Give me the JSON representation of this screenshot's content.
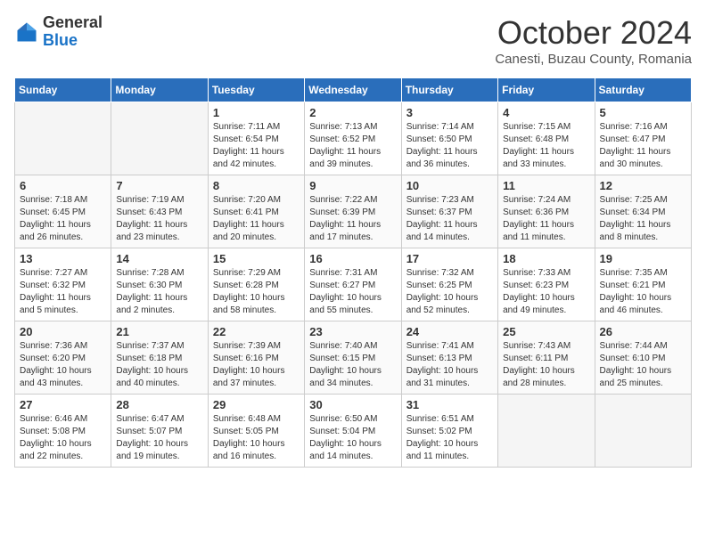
{
  "logo": {
    "general": "General",
    "blue": "Blue"
  },
  "title": "October 2024",
  "subtitle": "Canesti, Buzau County, Romania",
  "days_header": [
    "Sunday",
    "Monday",
    "Tuesday",
    "Wednesday",
    "Thursday",
    "Friday",
    "Saturday"
  ],
  "weeks": [
    [
      {
        "num": "",
        "info": "",
        "empty": true
      },
      {
        "num": "",
        "info": "",
        "empty": true
      },
      {
        "num": "1",
        "info": "Sunrise: 7:11 AM\nSunset: 6:54 PM\nDaylight: 11 hours and 42 minutes.",
        "empty": false
      },
      {
        "num": "2",
        "info": "Sunrise: 7:13 AM\nSunset: 6:52 PM\nDaylight: 11 hours and 39 minutes.",
        "empty": false
      },
      {
        "num": "3",
        "info": "Sunrise: 7:14 AM\nSunset: 6:50 PM\nDaylight: 11 hours and 36 minutes.",
        "empty": false
      },
      {
        "num": "4",
        "info": "Sunrise: 7:15 AM\nSunset: 6:48 PM\nDaylight: 11 hours and 33 minutes.",
        "empty": false
      },
      {
        "num": "5",
        "info": "Sunrise: 7:16 AM\nSunset: 6:47 PM\nDaylight: 11 hours and 30 minutes.",
        "empty": false
      }
    ],
    [
      {
        "num": "6",
        "info": "Sunrise: 7:18 AM\nSunset: 6:45 PM\nDaylight: 11 hours and 26 minutes.",
        "empty": false
      },
      {
        "num": "7",
        "info": "Sunrise: 7:19 AM\nSunset: 6:43 PM\nDaylight: 11 hours and 23 minutes.",
        "empty": false
      },
      {
        "num": "8",
        "info": "Sunrise: 7:20 AM\nSunset: 6:41 PM\nDaylight: 11 hours and 20 minutes.",
        "empty": false
      },
      {
        "num": "9",
        "info": "Sunrise: 7:22 AM\nSunset: 6:39 PM\nDaylight: 11 hours and 17 minutes.",
        "empty": false
      },
      {
        "num": "10",
        "info": "Sunrise: 7:23 AM\nSunset: 6:37 PM\nDaylight: 11 hours and 14 minutes.",
        "empty": false
      },
      {
        "num": "11",
        "info": "Sunrise: 7:24 AM\nSunset: 6:36 PM\nDaylight: 11 hours and 11 minutes.",
        "empty": false
      },
      {
        "num": "12",
        "info": "Sunrise: 7:25 AM\nSunset: 6:34 PM\nDaylight: 11 hours and 8 minutes.",
        "empty": false
      }
    ],
    [
      {
        "num": "13",
        "info": "Sunrise: 7:27 AM\nSunset: 6:32 PM\nDaylight: 11 hours and 5 minutes.",
        "empty": false
      },
      {
        "num": "14",
        "info": "Sunrise: 7:28 AM\nSunset: 6:30 PM\nDaylight: 11 hours and 2 minutes.",
        "empty": false
      },
      {
        "num": "15",
        "info": "Sunrise: 7:29 AM\nSunset: 6:28 PM\nDaylight: 10 hours and 58 minutes.",
        "empty": false
      },
      {
        "num": "16",
        "info": "Sunrise: 7:31 AM\nSunset: 6:27 PM\nDaylight: 10 hours and 55 minutes.",
        "empty": false
      },
      {
        "num": "17",
        "info": "Sunrise: 7:32 AM\nSunset: 6:25 PM\nDaylight: 10 hours and 52 minutes.",
        "empty": false
      },
      {
        "num": "18",
        "info": "Sunrise: 7:33 AM\nSunset: 6:23 PM\nDaylight: 10 hours and 49 minutes.",
        "empty": false
      },
      {
        "num": "19",
        "info": "Sunrise: 7:35 AM\nSunset: 6:21 PM\nDaylight: 10 hours and 46 minutes.",
        "empty": false
      }
    ],
    [
      {
        "num": "20",
        "info": "Sunrise: 7:36 AM\nSunset: 6:20 PM\nDaylight: 10 hours and 43 minutes.",
        "empty": false
      },
      {
        "num": "21",
        "info": "Sunrise: 7:37 AM\nSunset: 6:18 PM\nDaylight: 10 hours and 40 minutes.",
        "empty": false
      },
      {
        "num": "22",
        "info": "Sunrise: 7:39 AM\nSunset: 6:16 PM\nDaylight: 10 hours and 37 minutes.",
        "empty": false
      },
      {
        "num": "23",
        "info": "Sunrise: 7:40 AM\nSunset: 6:15 PM\nDaylight: 10 hours and 34 minutes.",
        "empty": false
      },
      {
        "num": "24",
        "info": "Sunrise: 7:41 AM\nSunset: 6:13 PM\nDaylight: 10 hours and 31 minutes.",
        "empty": false
      },
      {
        "num": "25",
        "info": "Sunrise: 7:43 AM\nSunset: 6:11 PM\nDaylight: 10 hours and 28 minutes.",
        "empty": false
      },
      {
        "num": "26",
        "info": "Sunrise: 7:44 AM\nSunset: 6:10 PM\nDaylight: 10 hours and 25 minutes.",
        "empty": false
      }
    ],
    [
      {
        "num": "27",
        "info": "Sunrise: 6:46 AM\nSunset: 5:08 PM\nDaylight: 10 hours and 22 minutes.",
        "empty": false
      },
      {
        "num": "28",
        "info": "Sunrise: 6:47 AM\nSunset: 5:07 PM\nDaylight: 10 hours and 19 minutes.",
        "empty": false
      },
      {
        "num": "29",
        "info": "Sunrise: 6:48 AM\nSunset: 5:05 PM\nDaylight: 10 hours and 16 minutes.",
        "empty": false
      },
      {
        "num": "30",
        "info": "Sunrise: 6:50 AM\nSunset: 5:04 PM\nDaylight: 10 hours and 14 minutes.",
        "empty": false
      },
      {
        "num": "31",
        "info": "Sunrise: 6:51 AM\nSunset: 5:02 PM\nDaylight: 10 hours and 11 minutes.",
        "empty": false
      },
      {
        "num": "",
        "info": "",
        "empty": true
      },
      {
        "num": "",
        "info": "",
        "empty": true
      }
    ]
  ]
}
